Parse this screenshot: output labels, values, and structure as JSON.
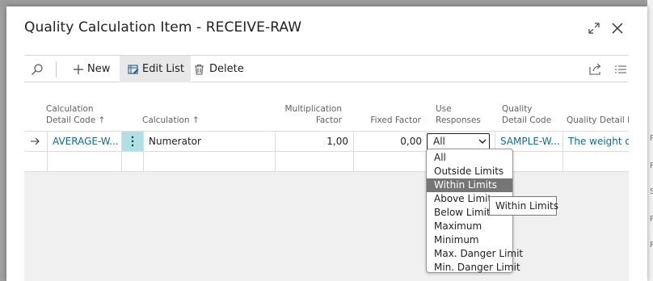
{
  "dialog": {
    "title": "Quality Calculation Item - RECEIVE-RAW"
  },
  "actions": {
    "new_label": "New",
    "edit_list_label": "Edit List",
    "delete_label": "Delete"
  },
  "columns": {
    "calc_detail_code": [
      "Calculation",
      "Detail Code ↑"
    ],
    "calculation": "Calculation ↑",
    "multiplication_factor": [
      "Multiplication",
      "Factor"
    ],
    "fixed_factor": "Fixed Factor",
    "use_responses": [
      "Use",
      "Responses"
    ],
    "quality_detail_code": [
      "Quality",
      "Detail Code"
    ],
    "quality_detail_desc": "Quality Detail Des"
  },
  "rows": [
    {
      "calc_detail_code": "AVERAGE-W...",
      "calculation": "Numerator",
      "multiplication_factor": "1,00",
      "fixed_factor": "0,00",
      "use_responses": "All",
      "quality_detail_code": "SAMPLE-W...",
      "quality_detail_desc": "The weight of t"
    }
  ],
  "dropdown": {
    "options": [
      "All",
      "Outside Limits",
      "Within Limits",
      "Above Limit",
      "Below Limit",
      "Maximum",
      "Minimum",
      "Max. Danger Limit",
      "Min. Danger Limit"
    ],
    "highlighted": "Within Limits"
  },
  "tooltip": "Within Limits",
  "background_right_letters": [
    "P",
    "P",
    "S",
    "P",
    "P"
  ]
}
